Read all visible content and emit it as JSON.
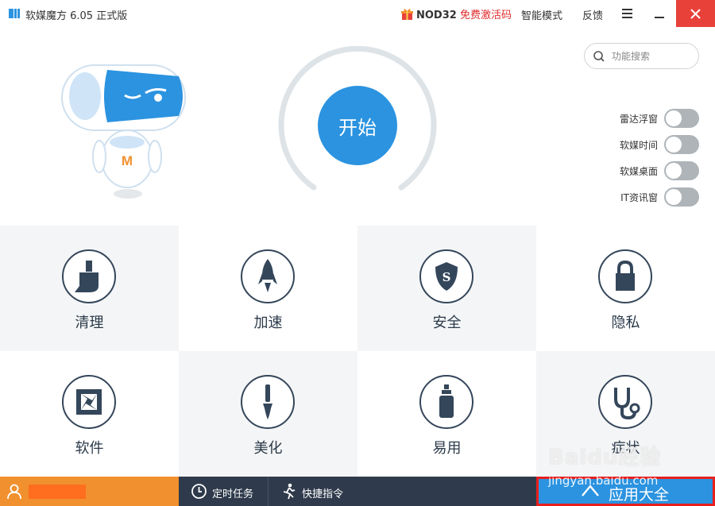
{
  "titlebar": {
    "title": "软媒魔方 6.05 正式版",
    "promo_brand": "NOD32",
    "promo_text": "免费激活码",
    "smart_mode": "智能模式",
    "feedback": "反馈"
  },
  "hero": {
    "start_label": "开始",
    "search_placeholder": "功能搜索",
    "mascot_badge": "M",
    "toggles": [
      {
        "label": "雷达浮窗",
        "on": false
      },
      {
        "label": "软媒时间",
        "on": false
      },
      {
        "label": "软媒桌面",
        "on": false
      },
      {
        "label": "IT资讯窗",
        "on": false
      }
    ]
  },
  "tiles": [
    {
      "label": "清理",
      "icon": "broom-icon"
    },
    {
      "label": "加速",
      "icon": "rocket-icon"
    },
    {
      "label": "安全",
      "icon": "shield-icon"
    },
    {
      "label": "隐私",
      "icon": "lock-icon"
    },
    {
      "label": "软件",
      "icon": "aperture-icon"
    },
    {
      "label": "美化",
      "icon": "paintbrush-icon"
    },
    {
      "label": "易用",
      "icon": "bottle-icon"
    },
    {
      "label": "症状",
      "icon": "stethoscope-icon"
    }
  ],
  "bottom": {
    "scheduled_tasks": "定时任务",
    "quick_commands": "快捷指令",
    "all_apps": "应用大全"
  },
  "watermark": {
    "brand": "Baidu经验",
    "url": "jingyan.baidu.com"
  },
  "colors": {
    "accent": "#2b93e0",
    "user_bar": "#f1902e",
    "bottom_bar": "#2f3b4c",
    "close": "#e8413a"
  }
}
